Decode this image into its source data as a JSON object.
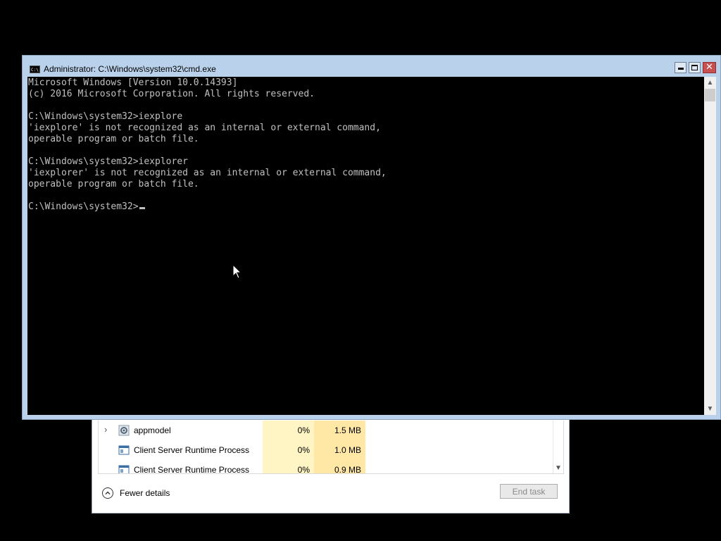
{
  "task_manager": {
    "rows": [
      {
        "name": "appmodel",
        "cpu": "0%",
        "memory": "1.5 MB",
        "expandable": true,
        "icon": "gear-icon"
      },
      {
        "name": "Client Server Runtime Process",
        "cpu": "0%",
        "memory": "1.0 MB",
        "expandable": false,
        "icon": "window-process-icon"
      },
      {
        "name": "Client Server Runtime Process",
        "cpu": "0%",
        "memory": "0.9 MB",
        "expandable": false,
        "icon": "window-process-icon"
      }
    ],
    "fewer_details_label": "Fewer details",
    "end_task_label": "End task"
  },
  "cmd": {
    "title": "Administrator: C:\\Windows\\system32\\cmd.exe",
    "output": "Microsoft Windows [Version 10.0.14393]\n(c) 2016 Microsoft Corporation. All rights reserved.\n\nC:\\Windows\\system32>iexplore\n'iexplore' is not recognized as an internal or external command,\noperable program or batch file.\n\nC:\\Windows\\system32>iexplorer\n'iexplorer' is not recognized as an internal or external command,\noperable program or batch file.\n\nC:\\Windows\\system32>"
  },
  "colors": {
    "console_bg": "#000000",
    "console_text": "#c0c0c0",
    "titlebar": "#b9d1ea",
    "close_button": "#c75050",
    "cpu_column": "#fff4c4",
    "memory_column": "#ffe8a6"
  }
}
